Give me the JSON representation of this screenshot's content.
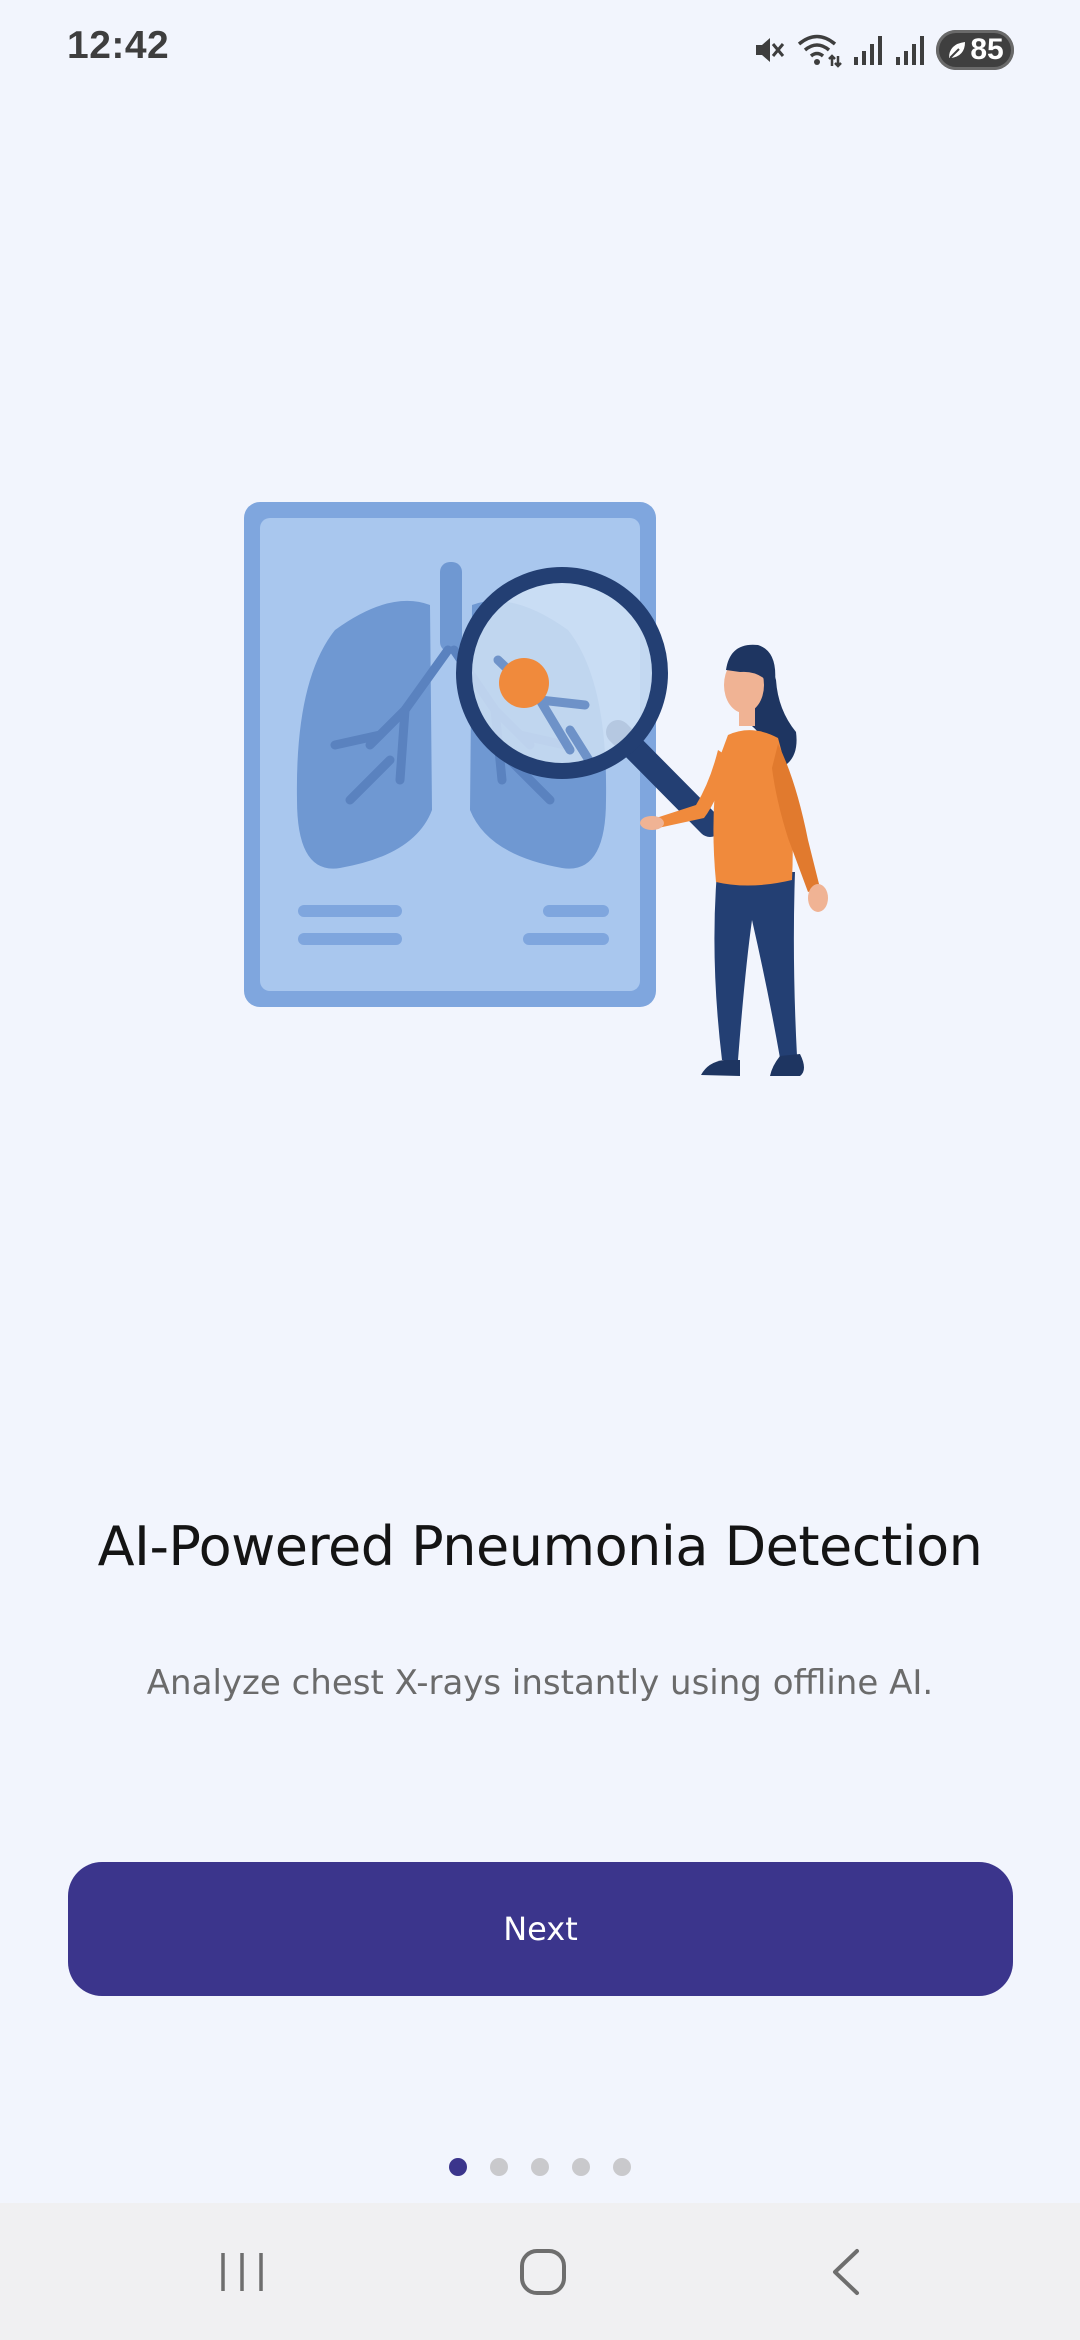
{
  "status_bar": {
    "time": "12:42",
    "battery_level": "85",
    "icons": [
      "mute-icon",
      "wifi-icon",
      "signal-icon",
      "signal-icon",
      "battery-saver-icon"
    ]
  },
  "onboarding": {
    "illustration": "xray-lungs-magnifier-woman",
    "title": "AI-Powered Pneumonia Detection",
    "subtitle": "Analyze chest X-rays instantly using offline AI.",
    "next_label": "Next",
    "page_count": 5,
    "active_page": 1
  },
  "nav_bar": {
    "buttons": [
      "recent-apps-icon",
      "home-icon",
      "back-icon"
    ]
  },
  "colors": {
    "background": "#f2f5fd",
    "accent": "#3b358c",
    "dot_inactive": "#c9c9cc",
    "illustration_orange": "#f08a3c",
    "illustration_navy": "#233f73"
  }
}
